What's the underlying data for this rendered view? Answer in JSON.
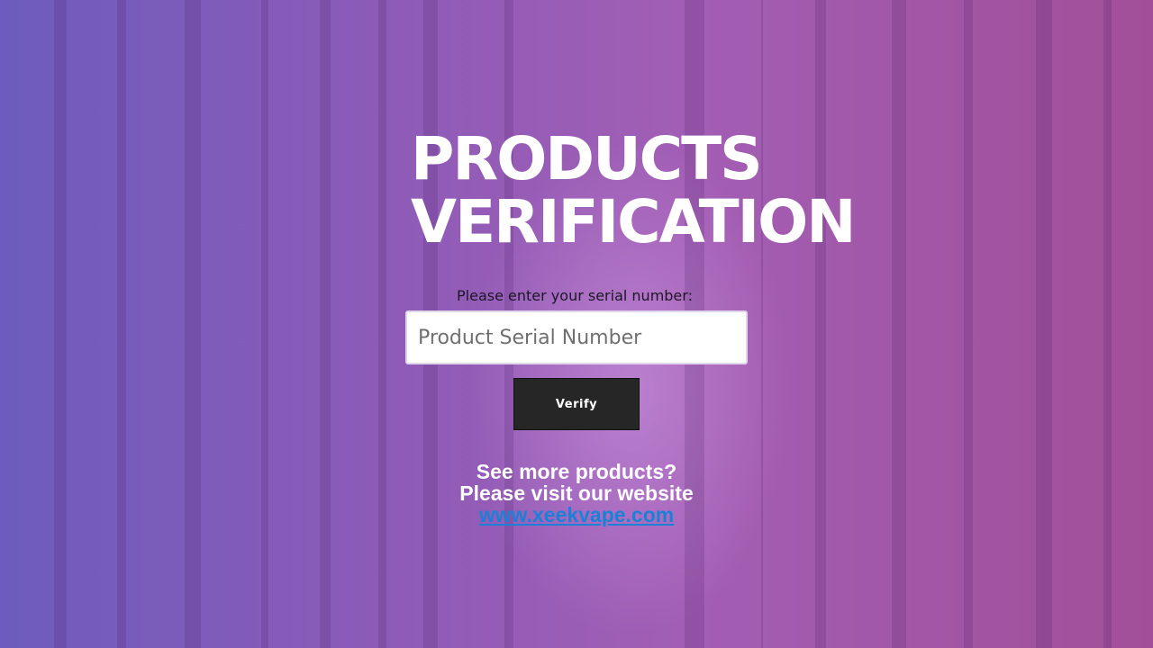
{
  "page": {
    "title_line1": "PRODUCTS",
    "title_line2": "VERIFICATION"
  },
  "form": {
    "prompt": "Please enter your serial number:",
    "serial_value": "",
    "serial_placeholder": "Product Serial Number",
    "verify_label": "Verify"
  },
  "promo": {
    "line1": "See more products?",
    "line2": "Please visit our website",
    "link_text": "www.xeekvape.com"
  },
  "colors": {
    "gradient_start": "#6d5cbd",
    "gradient_end": "#a24f98",
    "button_bg": "#262626",
    "link": "#1a82d6"
  },
  "icons": {
    "background": "forest-background-image"
  }
}
